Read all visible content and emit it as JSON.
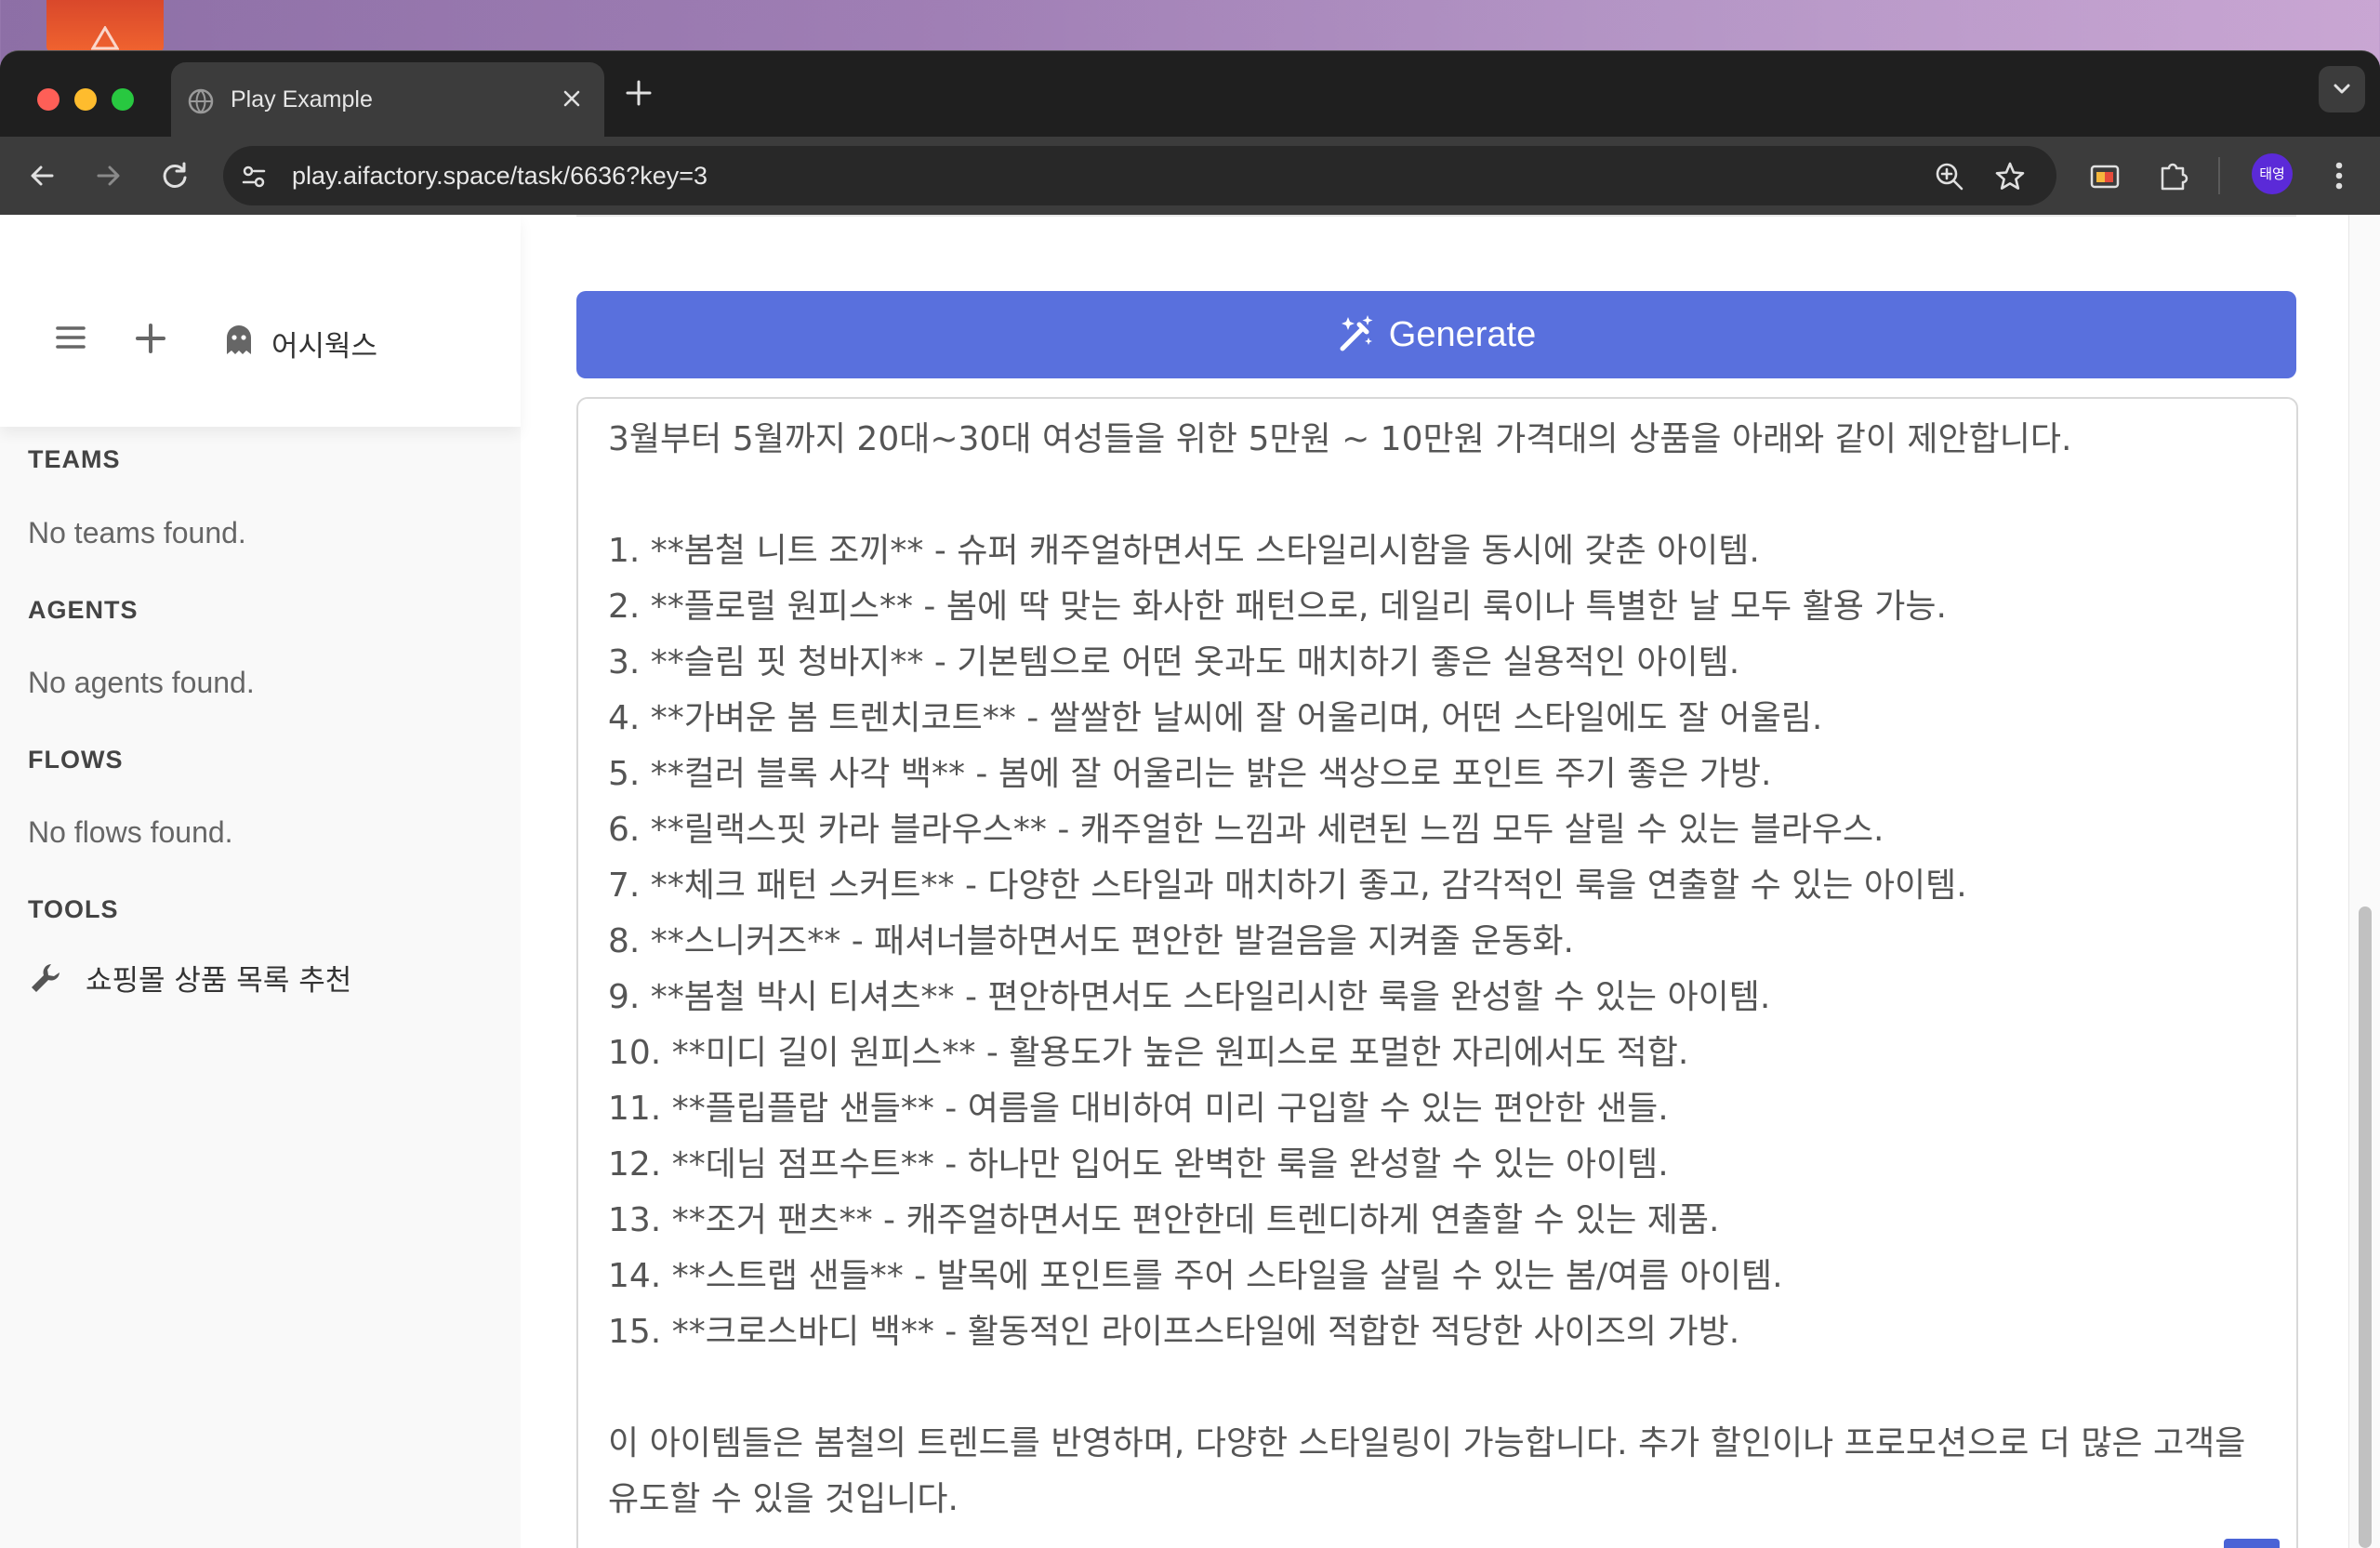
{
  "browser": {
    "tab_title": "Play Example",
    "url": "play.aifactory.space/task/6636?key=3",
    "profile_initials": "태영"
  },
  "sidebar": {
    "workspace_name": "어시웍스",
    "sections": {
      "teams": {
        "title": "TEAMS",
        "empty_text": "No teams found."
      },
      "agents": {
        "title": "AGENTS",
        "empty_text": "No agents found."
      },
      "flows": {
        "title": "FLOWS",
        "empty_text": "No flows found."
      },
      "tools": {
        "title": "TOOLS",
        "items": [
          "쇼핑몰 상품 목록 추천"
        ]
      }
    }
  },
  "main": {
    "generate_label": "Generate",
    "output": {
      "intro": "3월부터 5월까지 20대~30대 여성들을 위한 5만원 ~ 10만원 가격대의 상품을 아래와 같이 제안합니다.",
      "items": [
        "1. **봄철 니트 조끼** - 슈퍼 캐주얼하면서도 스타일리시함을 동시에 갖춘 아이템.",
        "2. **플로럴 원피스** - 봄에 딱 맞는 화사한 패턴으로, 데일리 룩이나 특별한 날 모두 활용 가능.",
        "3. **슬림 핏 청바지** - 기본템으로 어떤 옷과도 매치하기 좋은 실용적인 아이템.",
        "4. **가벼운 봄 트렌치코트** - 쌀쌀한 날씨에 잘 어울리며, 어떤 스타일에도 잘 어울림.",
        "5. **컬러 블록 사각 백** - 봄에 잘 어울리는 밝은 색상으로 포인트 주기 좋은 가방.",
        "6. **릴랙스핏 카라 블라우스** - 캐주얼한 느낌과 세련된 느낌 모두 살릴 수 있는 블라우스.",
        "7. **체크 패턴 스커트** - 다양한 스타일과 매치하기 좋고, 감각적인 룩을 연출할 수 있는 아이템.",
        "8. **스니커즈** - 패셔너블하면서도 편안한 발걸음을 지켜줄 운동화.",
        "9. **봄철 박시 티셔츠** - 편안하면서도 스타일리시한 룩을 완성할 수 있는 아이템.",
        "10. **미디 길이 원피스** - 활용도가 높은 원피스로 포멀한 자리에서도 적합.",
        "11. **플립플랍 샌들** - 여름을 대비하여 미리 구입할 수 있는 편안한 샌들.",
        "12. **데님 점프수트** - 하나만 입어도 완벽한 룩을 완성할 수 있는 아이템.",
        "13. **조거 팬츠** - 캐주얼하면서도 편안한데 트렌디하게 연출할 수 있는 제품.",
        "14. **스트랩 샌들** - 발목에 포인트를 주어 스타일을 살릴 수 있는 봄/여름 아이템.",
        "15. **크로스바디 백** - 활동적인 라이프스타일에 적합한 적당한 사이즈의 가방."
      ],
      "closing": "이 아이템들은 봄철의 트렌드를 반영하며, 다양한 스타일링이 가능합니다. 추가 할인이나 프로모션으로 더 많은 고객을 유도할 수 있을 것입니다."
    }
  },
  "colors": {
    "generate_button": "#5970dd",
    "browser_chrome": "#3c3c3c",
    "tab_strip": "#1f1f1f",
    "profile_avatar": "#5b2ad8"
  }
}
